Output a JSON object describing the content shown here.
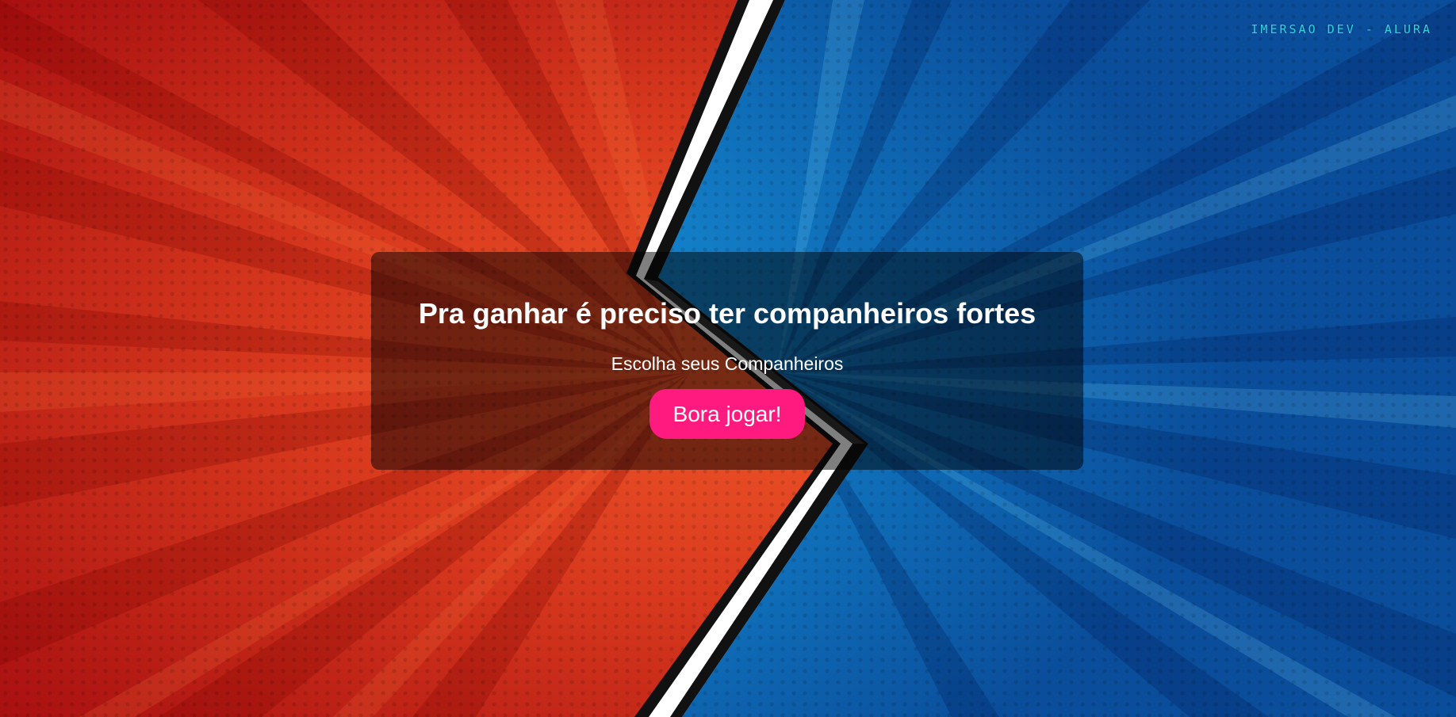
{
  "header": {
    "brand_label": "IMERSAO DEV - ALURA"
  },
  "card": {
    "title": "Pra ganhar é preciso ter companheiros fortes",
    "subtitle": "Escolha seus Companheiros",
    "play_button_label": "Bora jogar!"
  },
  "colors": {
    "left_panel": "#d22a18",
    "right_panel": "#1aa0dc",
    "accent_button": "#ff1a7f",
    "brand_text": "#2fd3e0"
  }
}
